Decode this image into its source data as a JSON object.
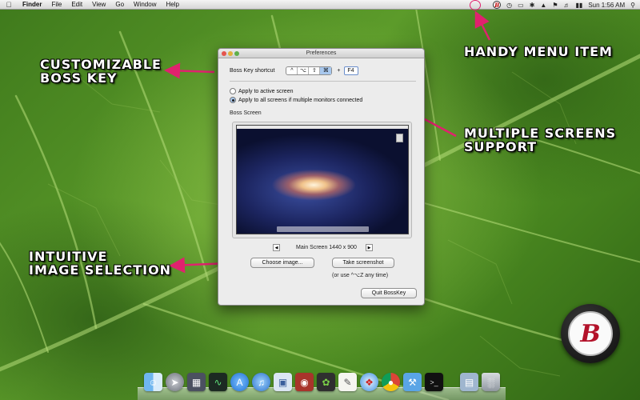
{
  "menubar": {
    "app": "Finder",
    "menus": [
      "File",
      "Edit",
      "View",
      "Go",
      "Window",
      "Help"
    ],
    "clock": "Sun 1:56 AM",
    "status_icon": "B"
  },
  "annotations": {
    "handy_menu": "Handy Menu Item",
    "boss_key_1": "Customizable",
    "boss_key_2": "Boss Key",
    "multi_1": "Multiple Screens",
    "multi_2": "Support",
    "image_1": "Intuitive",
    "image_2": "Image Selection"
  },
  "window": {
    "title": "Preferences",
    "shortcut_label": "Boss Key shortcut",
    "modifier_keys": [
      "^",
      "⌥",
      "⇧",
      "⌘"
    ],
    "plus": "+",
    "key": "F4",
    "radio_active": "Apply to active screen",
    "radio_all": "Apply to all screens if multiple monitors connected",
    "boss_screen_label": "Boss Screen",
    "screen_name": "Main Screen 1440 x 900",
    "choose_image": "Choose image...",
    "take_screenshot": "Take screenshot",
    "hint": "(or use ^⌥Z any time)",
    "quit": "Quit BossKey"
  },
  "badge": {
    "letter": "B"
  },
  "colors": {
    "accent": "#e0226e",
    "badge_letter": "#b3122a"
  },
  "dock_icons": [
    "finder-icon",
    "launchpad-icon",
    "mission-control-icon",
    "activity-monitor-icon",
    "app-store-icon",
    "itunes-icon",
    "preview-icon",
    "photo-booth-icon",
    "evernote-icon",
    "textedit-icon",
    "safari-icon",
    "chrome-icon",
    "xcode-icon",
    "terminal-icon",
    "folder-icon",
    "trash-icon"
  ]
}
